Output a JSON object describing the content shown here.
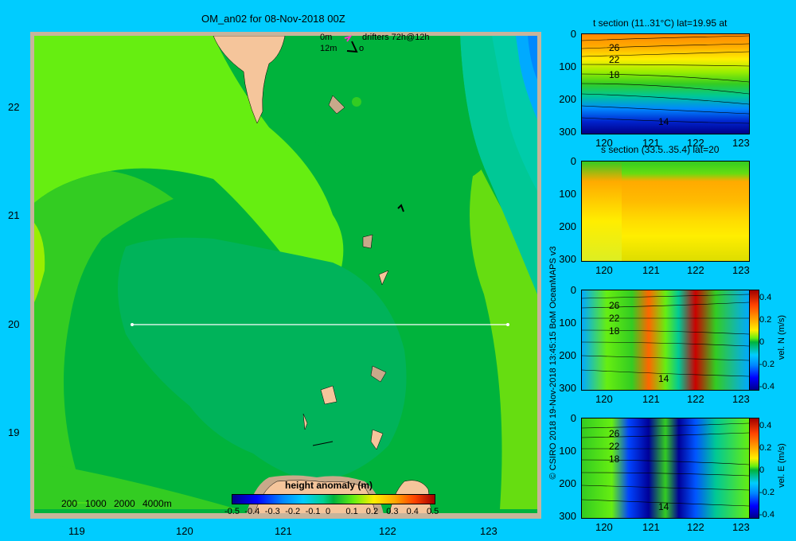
{
  "main_map": {
    "title": "OM_an02 for 08-Nov-2018 00Z",
    "legend": {
      "row1_depth": "0m",
      "row1_label": "drifters 72h@12h",
      "row2_depth": "12m",
      "row2_label": "o"
    },
    "x_ticks": [
      "119",
      "120",
      "121",
      "122",
      "123"
    ],
    "y_ticks": [
      "22",
      "21",
      "20",
      "19"
    ],
    "bathy_labels": [
      "200",
      "1000",
      "2000",
      "4000m"
    ],
    "colorbar": {
      "title": "height anomaly (m)",
      "ticks": [
        "-0.5",
        "-0.4",
        "-0.3",
        "-0.2",
        "-0.1",
        "0",
        "0.1",
        "0.2",
        "0.3",
        "0.4",
        "0.5"
      ]
    },
    "colors": {
      "land": "#f5c59b",
      "shelf": "#c8a98a",
      "frame": "#c8b49b"
    }
  },
  "panels": [
    {
      "title": "t section (11..31°C) lat=19.95 at",
      "y_ticks": [
        "0",
        "100",
        "200",
        "300"
      ],
      "x_ticks": [
        "120",
        "121",
        "122",
        "123"
      ],
      "contour_labels": [
        "26",
        "22",
        "18",
        "14"
      ]
    },
    {
      "title": "s section (33.5..35.4) lat=20",
      "y_ticks": [
        "0",
        "100",
        "200",
        "300"
      ],
      "x_ticks": [
        "120",
        "121",
        "122",
        "123"
      ]
    },
    {
      "title": "",
      "y_ticks": [
        "0",
        "100",
        "200",
        "300"
      ],
      "x_ticks": [
        "120",
        "121",
        "122",
        "123"
      ],
      "contour_labels": [
        "26",
        "22",
        "18",
        "14"
      ],
      "colorbar_ticks": [
        "0.4",
        "0.2",
        "0",
        "-0.2",
        "-0.4"
      ],
      "colorbar_label": "vel. N  (m/s)"
    },
    {
      "title": "",
      "y_ticks": [
        "0",
        "100",
        "200",
        "300"
      ],
      "x_ticks": [
        "120",
        "121",
        "122",
        "123"
      ],
      "contour_labels": [
        "26",
        "22",
        "18",
        "14"
      ],
      "colorbar_ticks": [
        "0.4",
        "0.2",
        "0",
        "-0.2",
        "-0.4"
      ],
      "colorbar_label": "vel. E  (m/s)"
    }
  ],
  "credit": "© CSIRO 2018  19-Nov-2018 13:45:15 BoM OceanMAPS v3"
}
